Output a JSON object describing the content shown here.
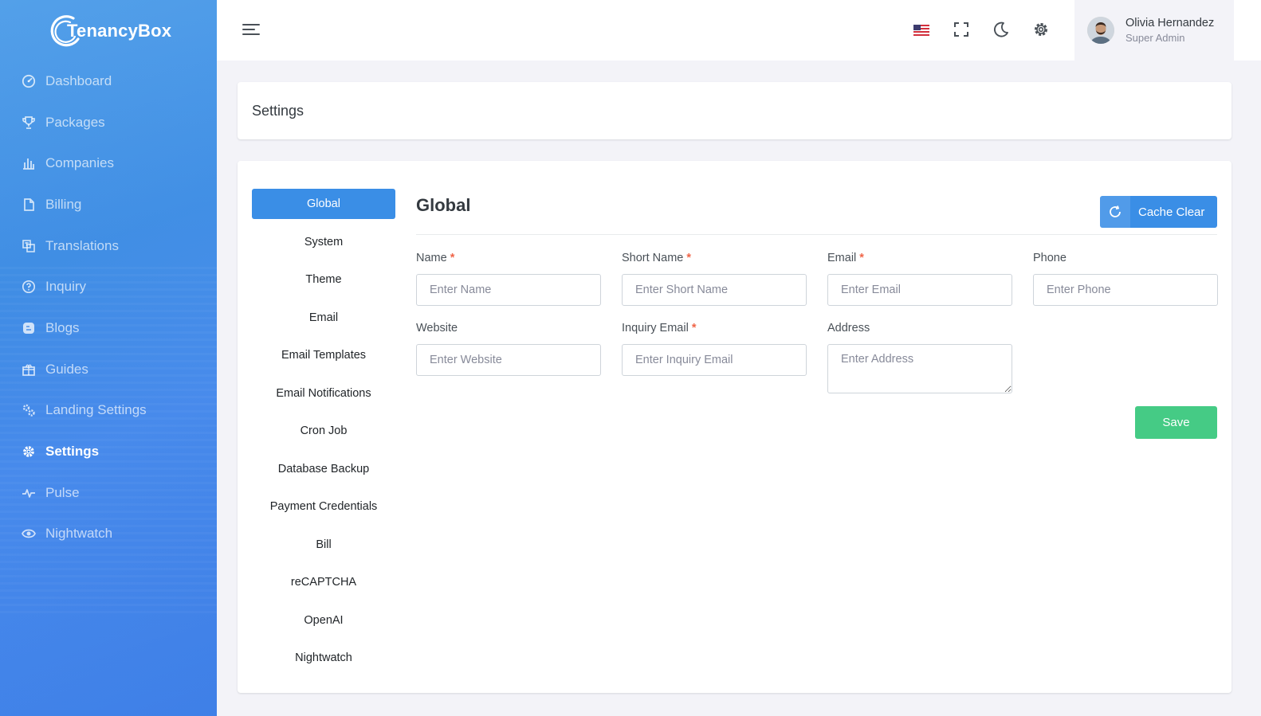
{
  "app": {
    "brand": "TenancyBox"
  },
  "sidebar": {
    "items": [
      {
        "label": "Dashboard",
        "icon": "dashboard-icon"
      },
      {
        "label": "Packages",
        "icon": "trophy-icon"
      },
      {
        "label": "Companies",
        "icon": "bar-chart-icon"
      },
      {
        "label": "Billing",
        "icon": "file-icon"
      },
      {
        "label": "Translations",
        "icon": "translate-icon"
      },
      {
        "label": "Inquiry",
        "icon": "question-circle-icon"
      },
      {
        "label": "Blogs",
        "icon": "blog-icon"
      },
      {
        "label": "Guides",
        "icon": "book-icon"
      },
      {
        "label": "Landing Settings",
        "icon": "gears-icon"
      },
      {
        "label": "Settings",
        "icon": "gear-icon",
        "active": true
      },
      {
        "label": "Pulse",
        "icon": "pulse-icon"
      },
      {
        "label": "Nightwatch",
        "icon": "eye-icon"
      }
    ]
  },
  "topbar": {
    "user": {
      "name": "Olivia Hernandez",
      "role": "Super Admin"
    }
  },
  "page": {
    "title": "Settings"
  },
  "settings_tabs": [
    "Global",
    "System",
    "Theme",
    "Email",
    "Email Templates",
    "Email Notifications",
    "Cron Job",
    "Database Backup",
    "Payment Credentials",
    "Bill",
    "reCAPTCHA",
    "OpenAI",
    "Nightwatch"
  ],
  "global": {
    "title": "Global",
    "cache_clear_label": "Cache Clear",
    "fields": {
      "name": {
        "label": "Name",
        "required": true,
        "placeholder": "Enter Name",
        "value": ""
      },
      "short_name": {
        "label": "Short Name",
        "required": true,
        "placeholder": "Enter Short Name",
        "value": ""
      },
      "email": {
        "label": "Email",
        "required": true,
        "placeholder": "Enter Email",
        "value": ""
      },
      "phone": {
        "label": "Phone",
        "required": false,
        "placeholder": "Enter Phone",
        "value": ""
      },
      "website": {
        "label": "Website",
        "required": false,
        "placeholder": "Enter Website",
        "value": ""
      },
      "inquiry_email": {
        "label": "Inquiry Email",
        "required": true,
        "placeholder": "Enter Inquiry Email",
        "value": ""
      },
      "address": {
        "label": "Address",
        "required": false,
        "placeholder": "Enter Address",
        "value": ""
      }
    },
    "save_label": "Save",
    "required_mark": "*"
  },
  "colors": {
    "primary": "#3a8ee6",
    "success": "#45cb85",
    "danger": "#f06548"
  }
}
